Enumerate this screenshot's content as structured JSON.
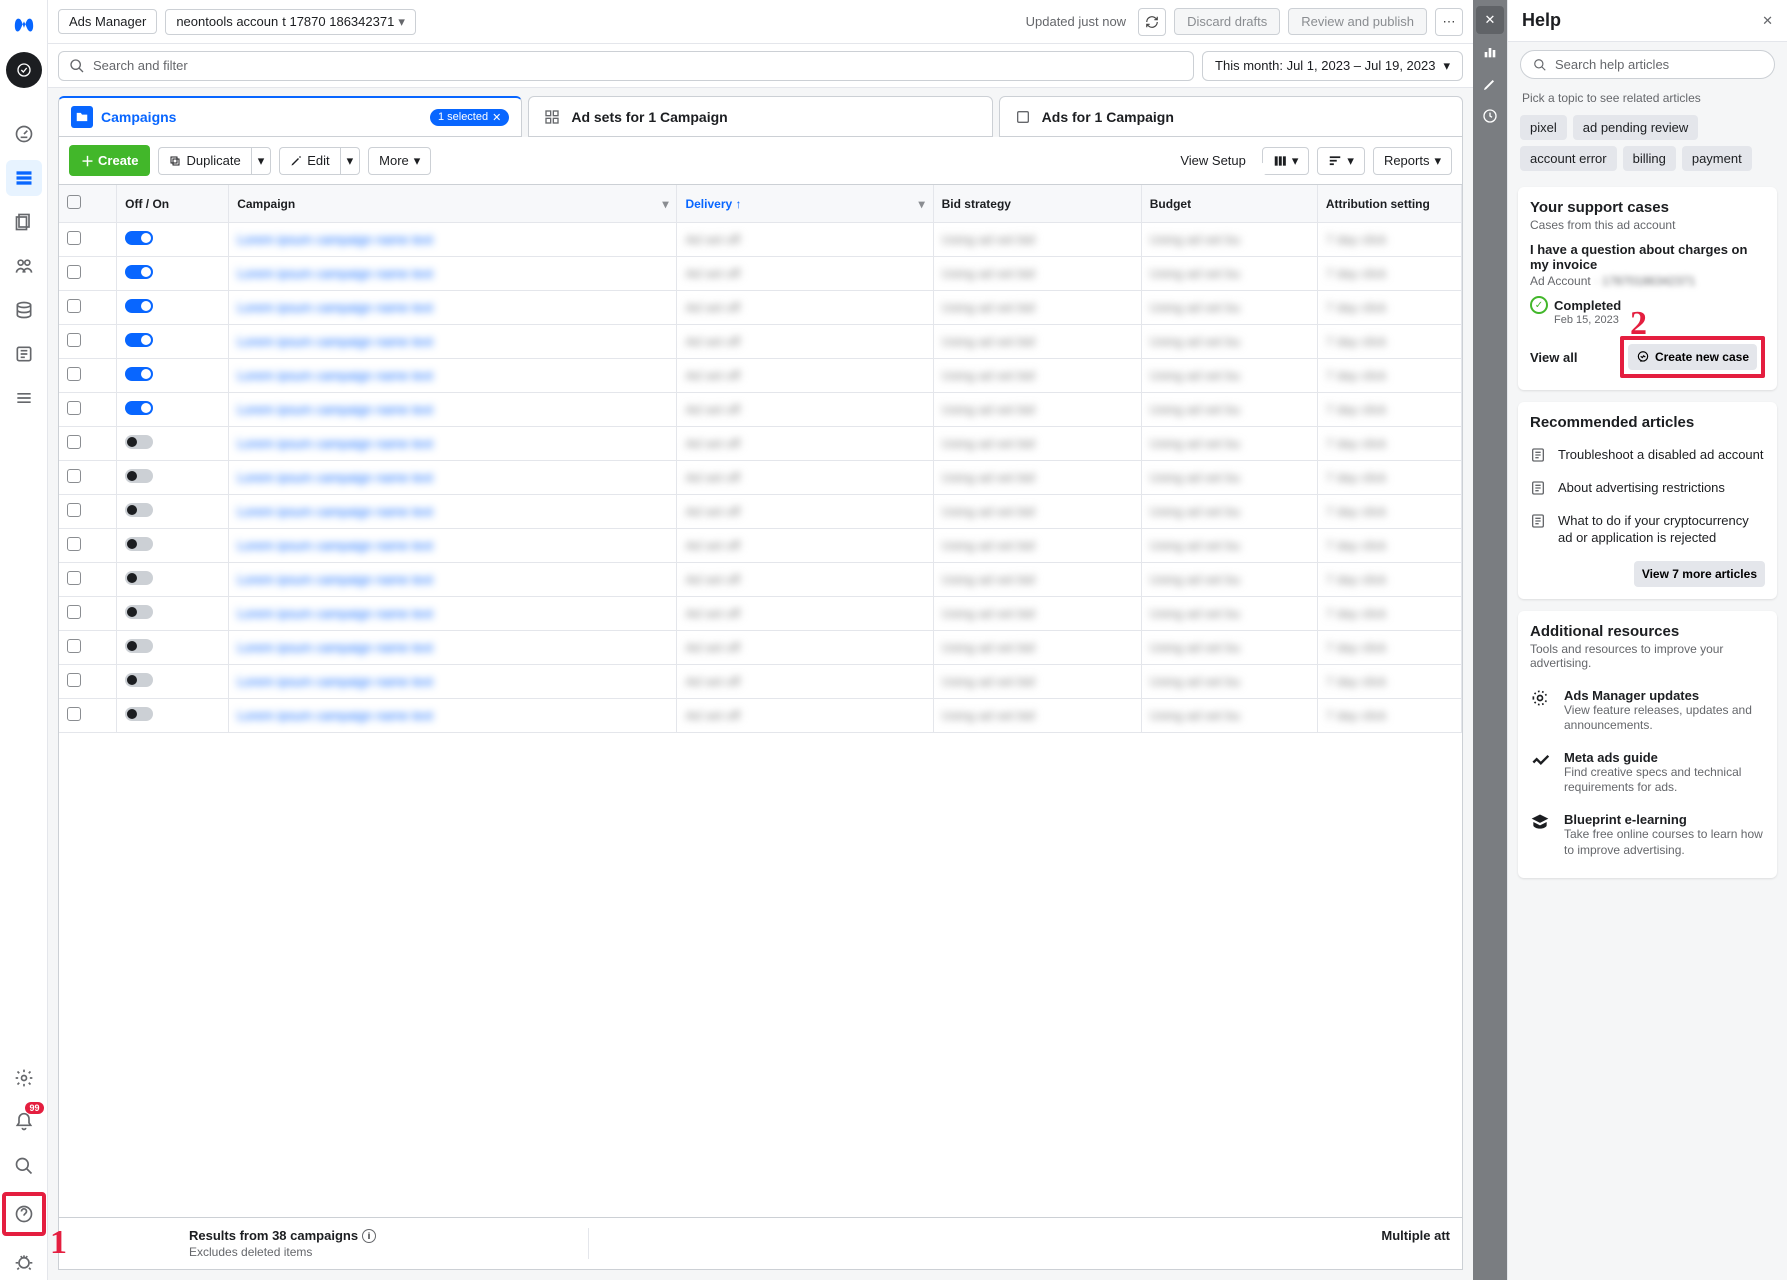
{
  "top": {
    "app": "Ads Manager",
    "account": "neontools accoun",
    "account_blur": "t 17870 186342371",
    "updated": "Updated just now",
    "discard": "Discard drafts",
    "review": "Review and publish"
  },
  "search": {
    "placeholder": "Search and filter",
    "date_range": "This month: Jul 1, 2023 – Jul 19, 2023"
  },
  "tabs": {
    "campaigns": "Campaigns",
    "selected_pill": "1 selected",
    "adsets": "Ad sets for 1 Campaign",
    "ads": "Ads for 1 Campaign"
  },
  "toolbar": {
    "create": "Create",
    "duplicate": "Duplicate",
    "edit": "Edit",
    "more": "More",
    "view_setup": "View Setup",
    "reports": "Reports"
  },
  "columns": {
    "offon": "Off / On",
    "campaign": "Campaign",
    "delivery": "Delivery",
    "bid": "Bid strategy",
    "budget": "Budget",
    "attribution": "Attribution setting"
  },
  "rows": [
    {
      "on": true
    },
    {
      "on": true
    },
    {
      "on": true
    },
    {
      "on": true
    },
    {
      "on": true
    },
    {
      "on": true
    },
    {
      "on": false
    },
    {
      "on": false
    },
    {
      "on": false
    },
    {
      "on": false
    },
    {
      "on": false
    },
    {
      "on": false
    },
    {
      "on": false
    },
    {
      "on": false
    },
    {
      "on": false
    }
  ],
  "footer": {
    "title": "Results from 38 campaigns",
    "sub": "Excludes deleted items",
    "right": "Multiple att"
  },
  "help": {
    "title": "Help",
    "search_placeholder": "Search help articles",
    "pick_topic": "Pick a topic to see related articles",
    "chips": [
      "pixel",
      "ad pending review",
      "account error",
      "billing",
      "payment"
    ],
    "cases": {
      "heading": "Your support cases",
      "sub": "Cases from this ad account",
      "case_title": "I have a question about charges on my invoice",
      "case_sub_prefix": "Ad Account",
      "case_sub_blur": "· 17870186342371",
      "status": "Completed",
      "status_date": "Feb 15, 2023",
      "view_all": "View all",
      "create_case": "Create new case"
    },
    "recommended": {
      "heading": "Recommended articles",
      "items": [
        "Troubleshoot a disabled ad account",
        "About advertising restrictions",
        "What to do if your cryptocurrency ad or application is rejected"
      ],
      "more": "View 7 more articles"
    },
    "resources": {
      "heading": "Additional resources",
      "sub": "Tools and resources to improve your advertising.",
      "items": [
        {
          "title": "Ads Manager updates",
          "desc": "View feature releases, updates and announcements."
        },
        {
          "title": "Meta ads guide",
          "desc": "Find creative specs and technical requirements for ads."
        },
        {
          "title": "Blueprint e-learning",
          "desc": "Take free online courses to learn how to improve advertising."
        }
      ]
    }
  },
  "annotations": {
    "one": "1",
    "two": "2"
  }
}
